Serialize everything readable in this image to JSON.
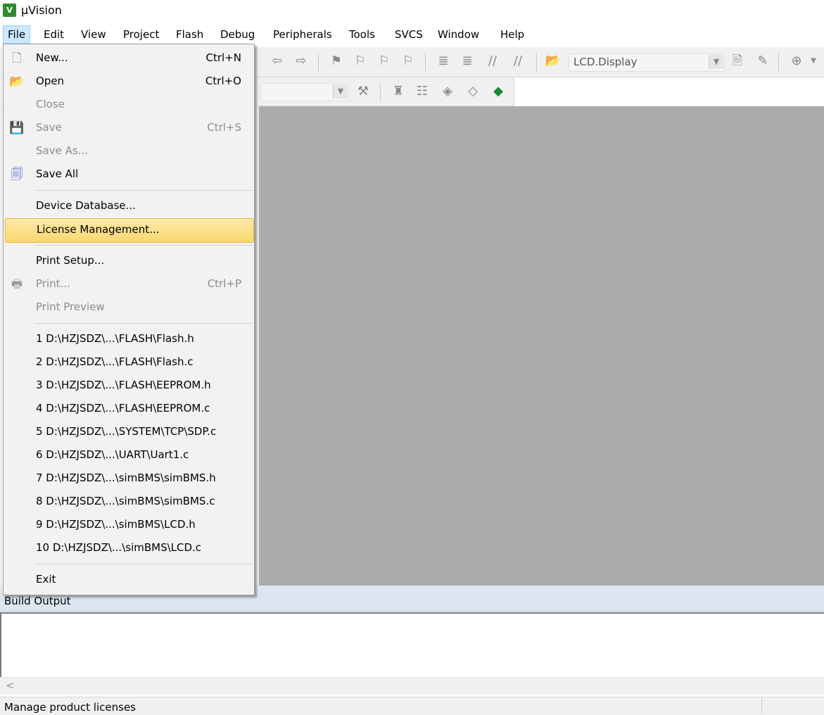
{
  "window": {
    "title": "µVision"
  },
  "menubar": {
    "items": [
      {
        "label": "File"
      },
      {
        "label": "Edit"
      },
      {
        "label": "View"
      },
      {
        "label": "Project"
      },
      {
        "label": "Flash"
      },
      {
        "label": "Debug"
      },
      {
        "label": "Peripherals"
      },
      {
        "label": "Tools"
      },
      {
        "label": "SVCS"
      },
      {
        "label": "Window"
      },
      {
        "label": "Help"
      }
    ]
  },
  "toolbar": {
    "target_name": "LCD.Display"
  },
  "file_menu": {
    "new": {
      "label": "New...",
      "shortcut": "Ctrl+N"
    },
    "open": {
      "label": "Open",
      "shortcut": "Ctrl+O"
    },
    "close": {
      "label": "Close"
    },
    "save": {
      "label": "Save",
      "shortcut": "Ctrl+S"
    },
    "save_as": {
      "label": "Save As..."
    },
    "save_all": {
      "label": "Save All"
    },
    "device_database": {
      "label": "Device Database..."
    },
    "license_management": {
      "label": "License Management..."
    },
    "print_setup": {
      "label": "Print Setup..."
    },
    "print": {
      "label": "Print...",
      "shortcut": "Ctrl+P"
    },
    "print_preview": {
      "label": "Print Preview"
    },
    "recent": [
      "1 D:\\HZJSDZ\\...\\FLASH\\Flash.h",
      "2 D:\\HZJSDZ\\...\\FLASH\\Flash.c",
      "3 D:\\HZJSDZ\\...\\FLASH\\EEPROM.h",
      "4 D:\\HZJSDZ\\...\\FLASH\\EEPROM.c",
      "5 D:\\HZJSDZ\\...\\SYSTEM\\TCP\\SDP.c",
      "6 D:\\HZJSDZ\\...\\UART\\Uart1.c",
      "7 D:\\HZJSDZ\\...\\simBMS\\simBMS.h",
      "8 D:\\HZJSDZ\\...\\simBMS\\simBMS.c",
      "9 D:\\HZJSDZ\\...\\simBMS\\LCD.h",
      "10 D:\\HZJSDZ\\...\\simBMS\\LCD.c"
    ],
    "exit": {
      "label": "Exit"
    }
  },
  "build_output": {
    "title": "Build Output"
  },
  "statusbar": {
    "text": "Manage product licenses"
  }
}
